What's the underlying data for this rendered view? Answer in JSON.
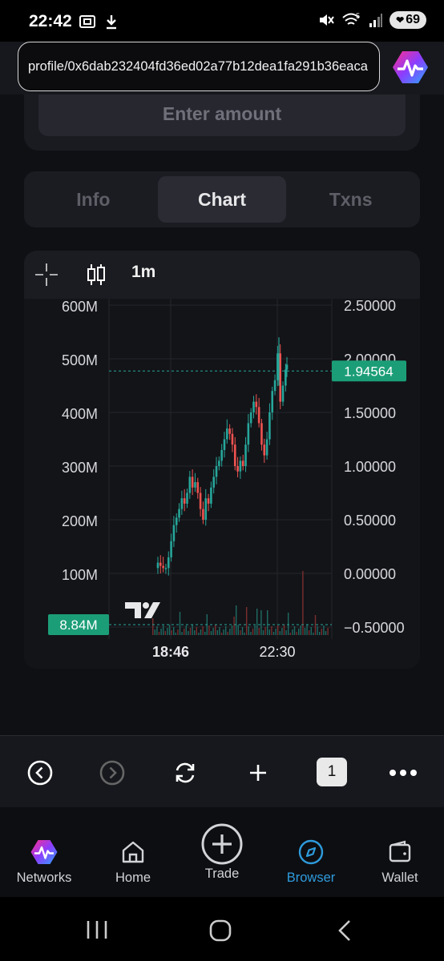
{
  "status_bar": {
    "time": "22:42",
    "battery": "69",
    "signal_label": "5",
    "icons": [
      "screenshot-icon",
      "download-icon",
      "mute-icon",
      "wifi-icon",
      "signal-icon",
      "battery-icon"
    ]
  },
  "url_bar": {
    "url": "profile/0x6dab232404fd36ed02a77b12dea1fa291b36eaca"
  },
  "amount_input": {
    "placeholder": "Enter amount"
  },
  "tabs": [
    {
      "label": "Info",
      "active": false
    },
    {
      "label": "Chart",
      "active": true
    },
    {
      "label": "Txns",
      "active": false
    }
  ],
  "chart_toolbar": {
    "interval": "1m",
    "icons": [
      "crosshair-icon",
      "candlestick-icon"
    ]
  },
  "chart_data": {
    "type": "candlestick",
    "left_axis": {
      "ticks": [
        "600M",
        "500M",
        "400M",
        "300M",
        "200M",
        "100M"
      ],
      "values": [
        600,
        500,
        400,
        300,
        200,
        100
      ],
      "unit": "M"
    },
    "right_axis": {
      "ticks": [
        "2.50000",
        "2.00000",
        "1.50000",
        "1.00000",
        "0.50000",
        "0.00000",
        "−0.50000"
      ],
      "values": [
        2.5,
        2.0,
        1.5,
        1.0,
        0.5,
        0.0,
        -0.5
      ]
    },
    "x_ticks": [
      "18:46",
      "22:30"
    ],
    "current_price_label": "1.94564",
    "current_price": 1.94564,
    "left_marker_label": "8.84M",
    "left_marker_value": 8.84,
    "price_path": [
      [
        0.0,
        0.05
      ],
      [
        0.03,
        0.1
      ],
      [
        0.05,
        0.07
      ],
      [
        0.07,
        0.05
      ],
      [
        0.09,
        0.05
      ],
      [
        0.11,
        0.15
      ],
      [
        0.13,
        0.3
      ],
      [
        0.15,
        0.45
      ],
      [
        0.17,
        0.52
      ],
      [
        0.19,
        0.6
      ],
      [
        0.21,
        0.7
      ],
      [
        0.23,
        0.65
      ],
      [
        0.25,
        0.75
      ],
      [
        0.27,
        0.9
      ],
      [
        0.29,
        0.8
      ],
      [
        0.31,
        0.85
      ],
      [
        0.33,
        0.75
      ],
      [
        0.35,
        0.6
      ],
      [
        0.37,
        0.5
      ],
      [
        0.39,
        0.7
      ],
      [
        0.41,
        0.65
      ],
      [
        0.43,
        0.8
      ],
      [
        0.45,
        0.9
      ],
      [
        0.47,
        1.0
      ],
      [
        0.49,
        1.05
      ],
      [
        0.51,
        1.15
      ],
      [
        0.53,
        1.25
      ],
      [
        0.55,
        1.35
      ],
      [
        0.57,
        1.3
      ],
      [
        0.59,
        1.2
      ],
      [
        0.61,
        1.0
      ],
      [
        0.63,
        0.95
      ],
      [
        0.65,
        1.05
      ],
      [
        0.67,
        1.0
      ],
      [
        0.69,
        1.2
      ],
      [
        0.71,
        1.4
      ],
      [
        0.73,
        1.5
      ],
      [
        0.75,
        1.6
      ],
      [
        0.77,
        1.55
      ],
      [
        0.79,
        1.4
      ],
      [
        0.81,
        1.2
      ],
      [
        0.83,
        1.1
      ],
      [
        0.85,
        1.25
      ],
      [
        0.87,
        1.5
      ],
      [
        0.89,
        1.7
      ],
      [
        0.91,
        1.8
      ],
      [
        0.93,
        2.05
      ],
      [
        0.95,
        1.6
      ],
      [
        0.97,
        1.75
      ],
      [
        0.99,
        1.9
      ],
      [
        1.0,
        1.94564
      ]
    ],
    "colors": {
      "up": "#26a69a",
      "down": "#ef5350",
      "price_tag": "#1b9e77"
    }
  },
  "browser_bar": {
    "tab_count": "1",
    "buttons": [
      "back-button",
      "forward-button",
      "refresh-button",
      "new-tab-button",
      "tabs-button",
      "more-button"
    ]
  },
  "bottom_nav": [
    {
      "label": "Networks",
      "icon": "networks-logo-icon",
      "active": false
    },
    {
      "label": "Home",
      "icon": "home-icon",
      "active": false
    },
    {
      "label": "Trade",
      "icon": "plus-circle-icon",
      "active": false
    },
    {
      "label": "Browser",
      "icon": "compass-icon",
      "active": true
    },
    {
      "label": "Wallet",
      "icon": "wallet-icon",
      "active": false
    }
  ],
  "colors": {
    "accent_active": "#2e9bdc",
    "background": "#0f1014",
    "card": "#1b1c21"
  }
}
